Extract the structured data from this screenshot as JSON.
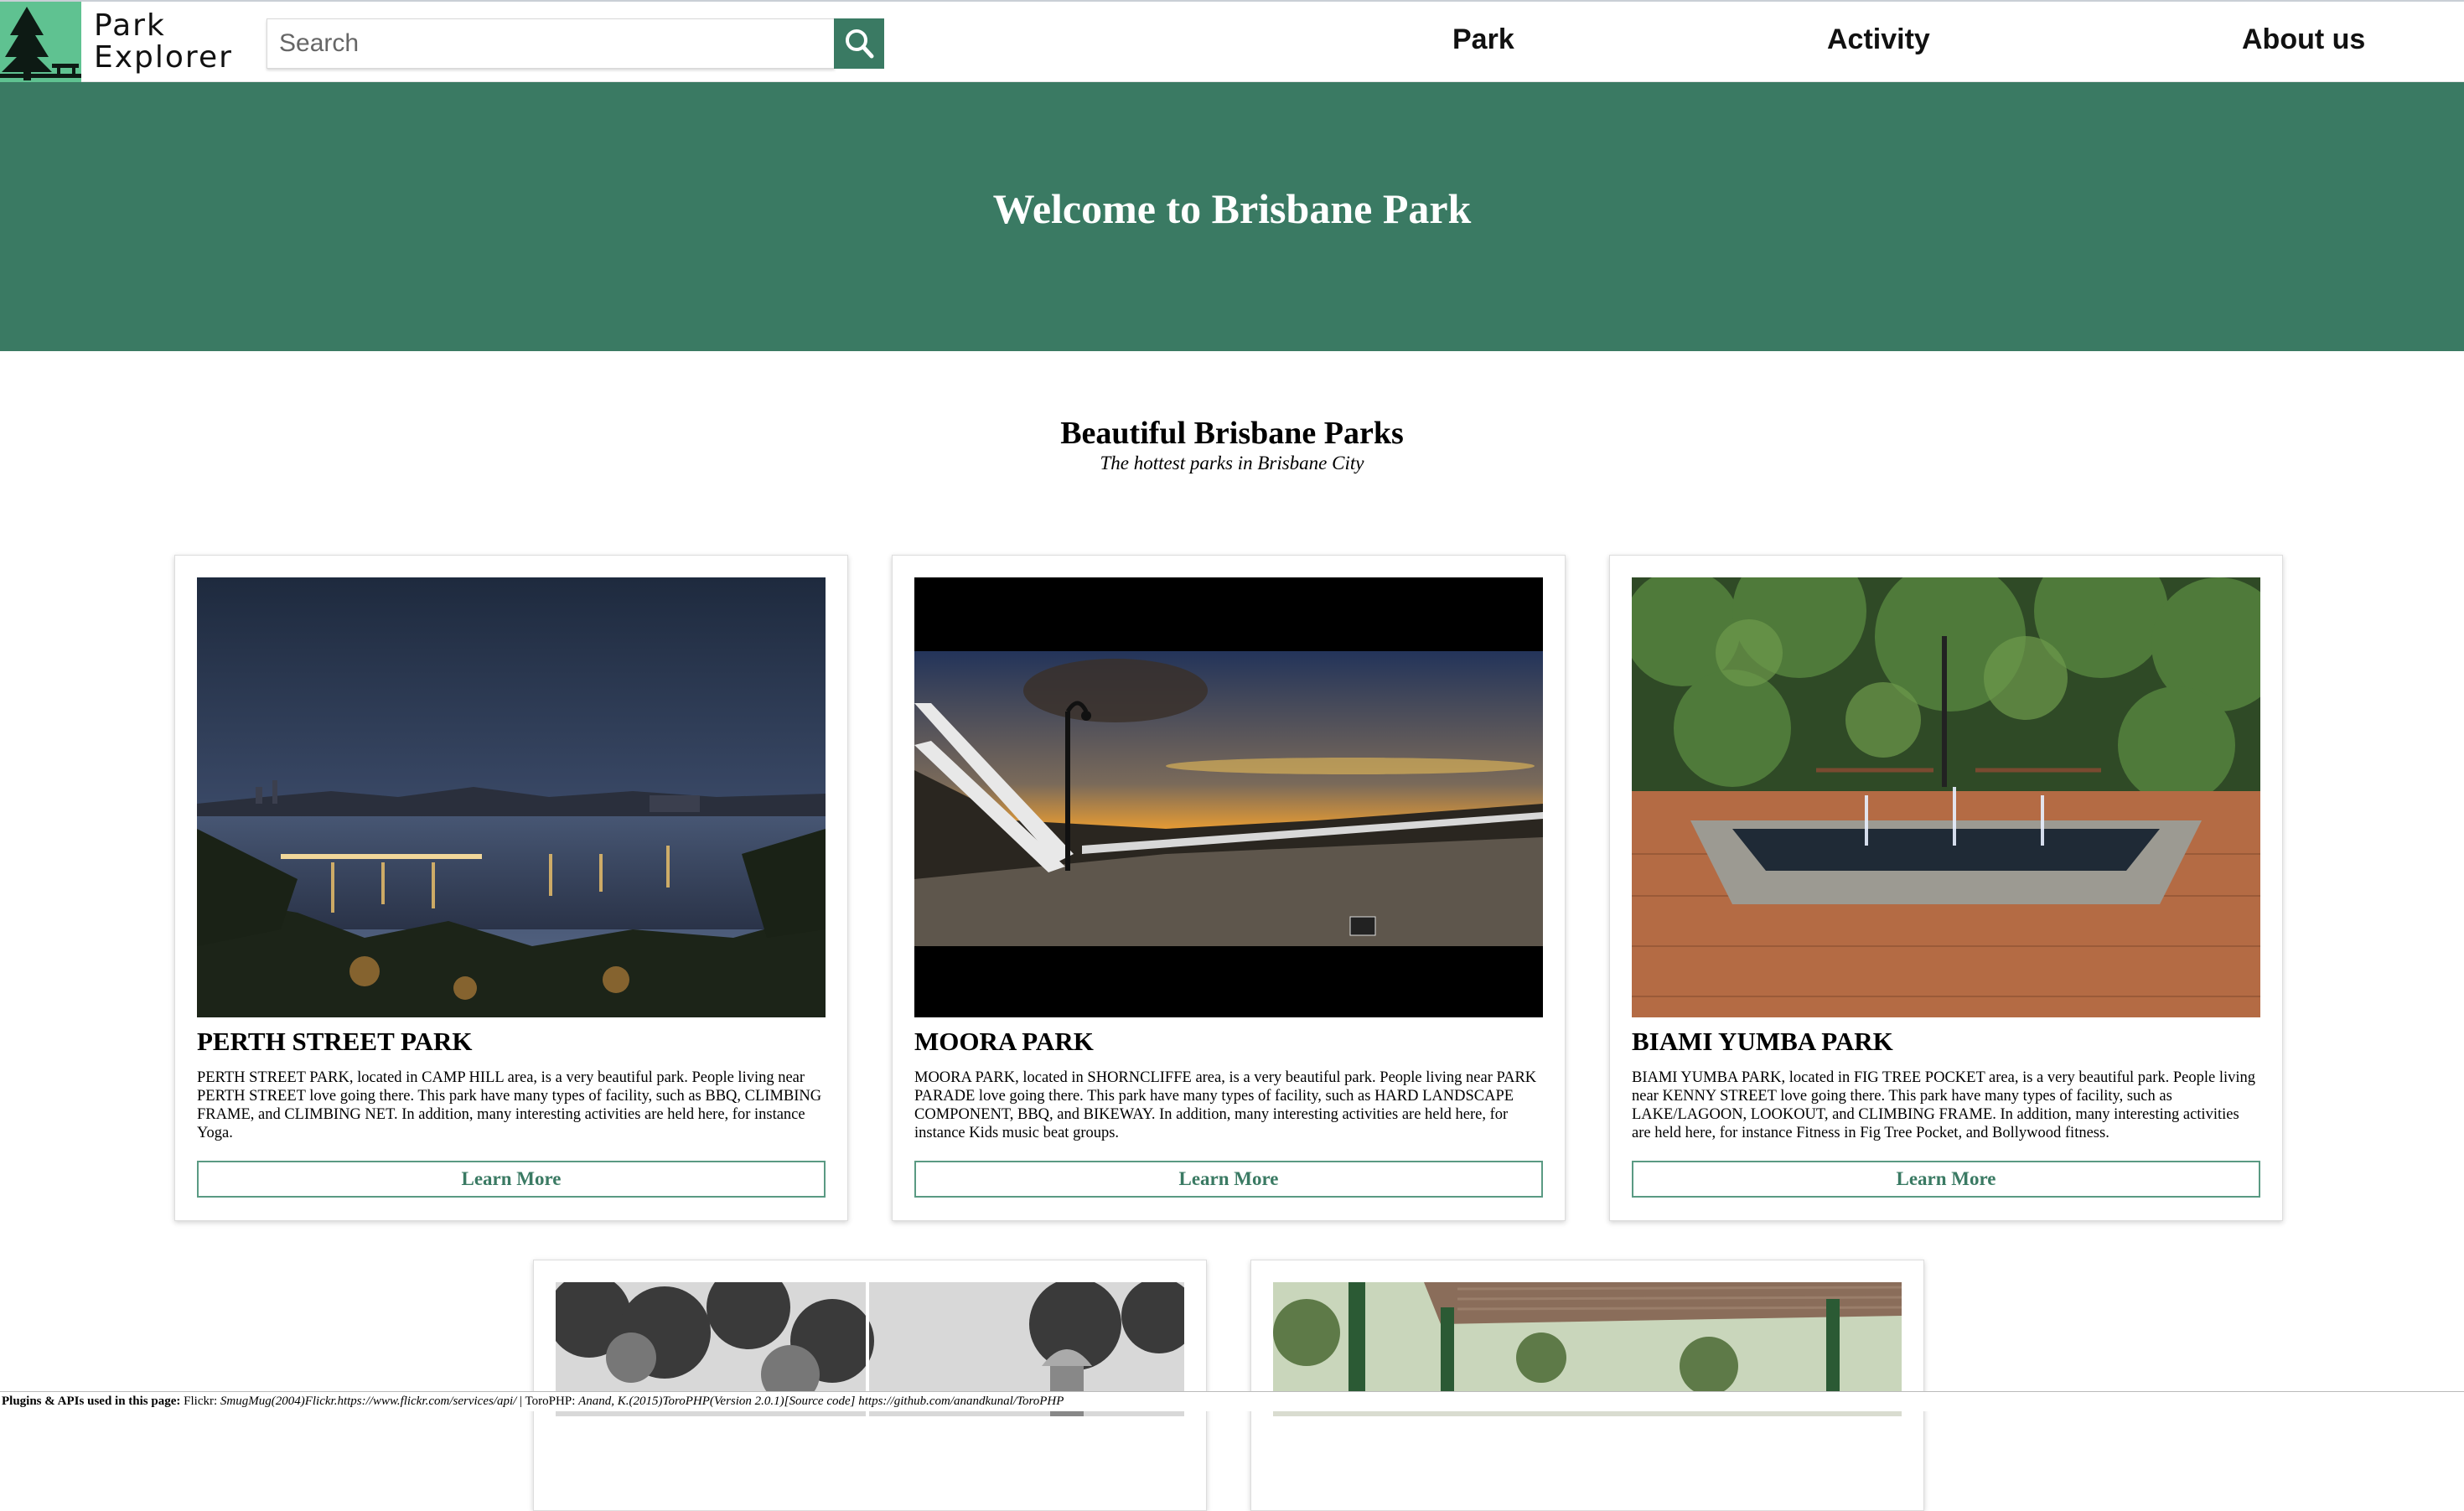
{
  "brand": {
    "line1": "Park",
    "line2": "Explorer",
    "accent": "#3a7a63",
    "logo_bg": "#5fc291"
  },
  "search": {
    "placeholder": "Search",
    "value": "",
    "icon": "search-icon"
  },
  "nav": {
    "items": [
      "Park",
      "Activity",
      "About us"
    ]
  },
  "hero": {
    "title": "Welcome to Brisbane Park"
  },
  "section": {
    "title": "Beautiful Brisbane Parks",
    "subtitle": "The hottest parks in Brisbane City"
  },
  "cards": [
    {
      "title": "PERTH STREET PARK",
      "description": "PERTH STREET PARK, located in CAMP HILL area, is a very beautiful park. People living near PERTH STREET love going there. This park have many types of facility, such as BBQ, CLIMBING FRAME, and CLIMBING NET. In addition, many interesting activities are held here, for instance Yoga.",
      "button": "Learn More"
    },
    {
      "title": "MOORA PARK",
      "description": "MOORA PARK, located in SHORNCLIFFE area, is a very beautiful park. People living near PARK PARADE love going there. This park have many types of facility, such as HARD LANDSCAPE COMPONENT, BBQ, and BIKEWAY. In addition, many interesting activities are held here, for instance Kids music beat groups.",
      "button": "Learn More"
    },
    {
      "title": "BIAMI YUMBA PARK",
      "description": "BIAMI YUMBA PARK, located in FIG TREE POCKET area, is a very beautiful park. People living near KENNY STREET love going there. This park have many types of facility, such as LAKE/LAGOON, LOOKOUT, and CLIMBING FRAME. In addition, many interesting activities are held here, for instance Fitness in Fig Tree Pocket, and Bollywood fitness.",
      "button": "Learn More"
    }
  ],
  "footer": {
    "label": "Plugins & APIs used in this page:",
    "flickr_name": "Flickr:",
    "flickr_ref": "SmugMug(2004)Flickr.https://www.flickr.com/services/api/",
    "sep": " | ToroPHP:",
    "toro_ref": "Anand, K.(2015)ToroPHP(Version 2.0.1)[Source code] https://github.com/anandkunal/ToroPHP"
  }
}
